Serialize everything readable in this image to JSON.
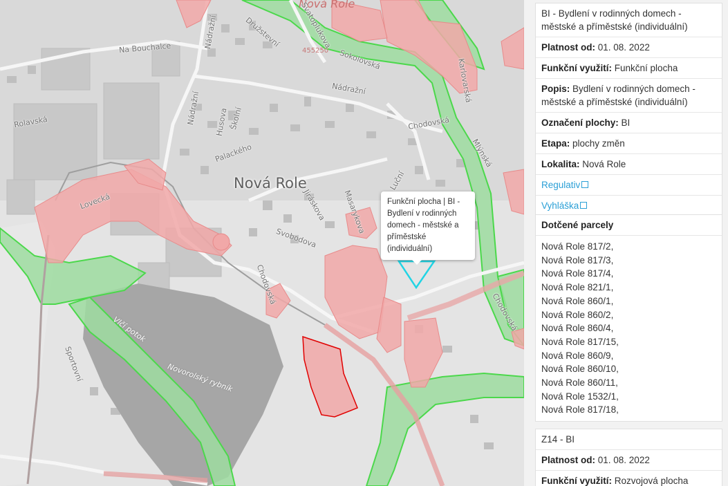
{
  "map": {
    "place_labels": {
      "town": "Nová Role",
      "town_top": "Nová Role",
      "elevation": "455250",
      "pond": "Novorolský rybník",
      "stream": "Vlčí potok"
    },
    "streets": [
      "Na Bouchalce",
      "Nádražní",
      "Nádražní",
      "Nádražní",
      "Svatoplukova",
      "Chodovská",
      "Chodovská",
      "Chodovská",
      "Svobodova",
      "Luční",
      "Lovecká",
      "Husova",
      "Školní",
      "Družstevní",
      "Palackého",
      "Jiráskova",
      "Masarykova",
      "Sokolovská",
      "Mlýnská",
      "Karlovarská",
      "Rolavská",
      "Sportovní"
    ],
    "tooltip": "Funkční plocha | BI - Bydlení v rodinných domech - městské a příměstské (individuální)",
    "colors": {
      "background": "#e6e6e6",
      "build_zone_fill": "#f1a8a8",
      "build_zone_stroke": "#e05a5a",
      "selected_outline": "#21d4e4",
      "green_zone": "#9ddca0",
      "green_stroke": "#4bd84b",
      "water_body": "#a5a5a5",
      "red_outline": "#e00000"
    }
  },
  "panel": {
    "card1": {
      "title": "BI - Bydlení v rodinných domech - městské a příměstské (individuální)",
      "rows": [
        {
          "label": "Platnost od:",
          "value": "01. 08. 2022"
        },
        {
          "label": "Funkční využití:",
          "value": "Funkční plocha"
        },
        {
          "label": "Popis:",
          "value": "Bydlení v rodinných domech - městské a příměstské (individuální)"
        },
        {
          "label": "Označení plochy:",
          "value": "BI"
        },
        {
          "label": "Etapa:",
          "value": "plochy změn"
        },
        {
          "label": "Lokalita:",
          "value": "Nová Role"
        }
      ],
      "links": [
        "Regulativ",
        "Vyhláška"
      ],
      "link_icon": "external-link-icon"
    },
    "parcels": {
      "title": "Dotčené parcely",
      "items": [
        "Nová Role 817/2,",
        "Nová Role 817/3,",
        "Nová Role 817/4,",
        "Nová Role 821/1,",
        "Nová Role 860/1,",
        "Nová Role 860/2,",
        "Nová Role 860/4,",
        "Nová Role 817/15,",
        "Nová Role 860/9,",
        "Nová Role 860/10,",
        "Nová Role 860/11,",
        "Nová Role 1532/1,",
        "Nová Role 817/18,"
      ]
    },
    "card2": {
      "title": "Z14 - BI",
      "rows": [
        {
          "label": "Platnost od:",
          "value": "01. 08. 2022"
        },
        {
          "label": "Funkční využití:",
          "value": "Rozvojová plocha"
        }
      ]
    }
  }
}
